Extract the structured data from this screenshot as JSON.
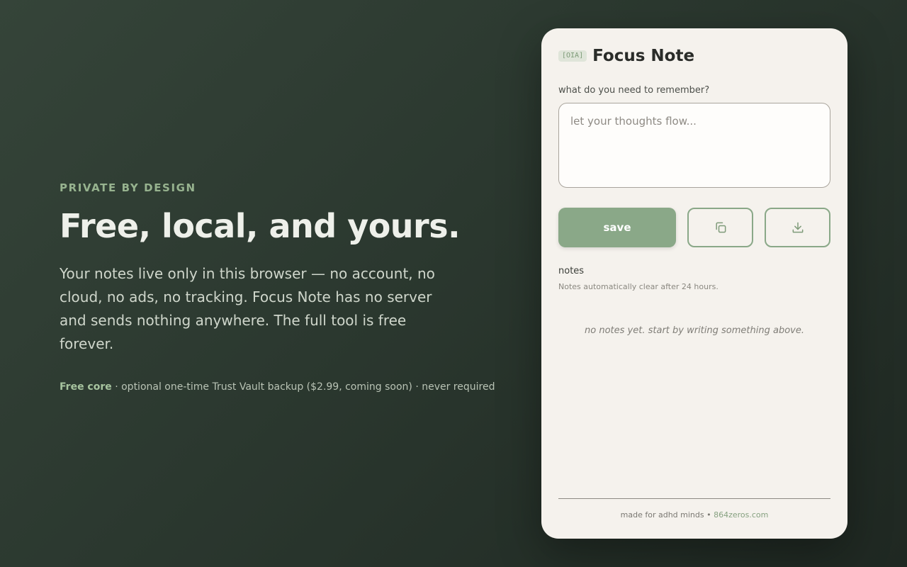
{
  "hero": {
    "eyebrow": "PRIVATE BY DESIGN",
    "headline": "Free, local, and yours.",
    "lede": "Your notes live only in this browser — no account, no cloud, no ads, no tracking. Focus Note has no server and sends nothing anywhere. The full tool is free forever.",
    "fine_strong": "Free core",
    "fine_rest": " · optional one-time Trust Vault backup ($2.99, coming soon) · never required"
  },
  "card": {
    "brand_mark": "[OIA]",
    "title": "Focus Note",
    "field_label": "what do you need to remember?",
    "input_placeholder": "let your thoughts flow...",
    "input_value": "",
    "save_label": "save",
    "copy_icon": "copy-icon",
    "download_icon": "download-icon",
    "notes_heading": "notes",
    "notes_sub": "Notes automatically clear after 24 hours.",
    "empty_state": "no notes yet. start by writing something above."
  },
  "footer": {
    "text": "made for adhd minds • ",
    "link": "864zeros.com"
  },
  "colors": {
    "accent": "#8aa888",
    "bg_dark": "#2b382f",
    "card_bg": "#f5f2ed"
  }
}
